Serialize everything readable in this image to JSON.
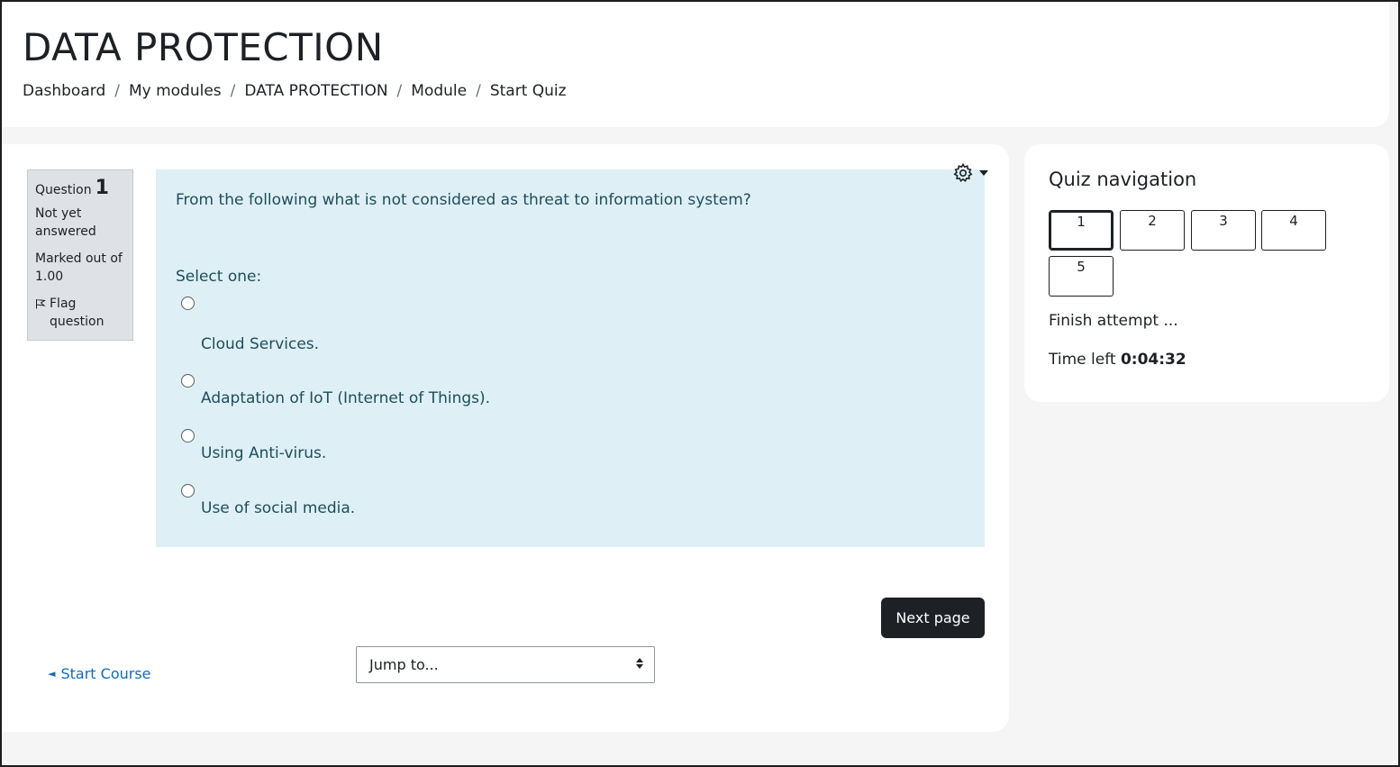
{
  "header": {
    "title": "DATA PROTECTION",
    "breadcrumb": [
      "Dashboard",
      "My modules",
      "DATA PROTECTION",
      "Module",
      "Start Quiz"
    ]
  },
  "question_info": {
    "question_label": "Question",
    "question_number": "1",
    "state": "Not yet answered",
    "grade": "Marked out of 1.00",
    "flag_label": "Flag question"
  },
  "question": {
    "text": "From the following what is not considered as threat to information system?",
    "prompt": "Select one:",
    "options": [
      "Cloud Services.",
      "Adaptation of IoT (Internet of Things).",
      "Using Anti-virus.",
      "Use of social media."
    ]
  },
  "footer": {
    "next_label": "Next page",
    "start_course_label": "Start Course",
    "jump_to_label": "Jump to..."
  },
  "quiz_nav": {
    "title": "Quiz navigation",
    "buttons": [
      "1",
      "2",
      "3",
      "4",
      "5"
    ],
    "current": "1",
    "finish_label": "Finish attempt ...",
    "time_left_label": "Time left",
    "time_left_value": "0:04:32"
  },
  "colors": {
    "accent_link": "#0f6cbf",
    "question_bg": "#def0f6",
    "info_bg": "#dee2e6",
    "button_dark": "#1d2125"
  }
}
